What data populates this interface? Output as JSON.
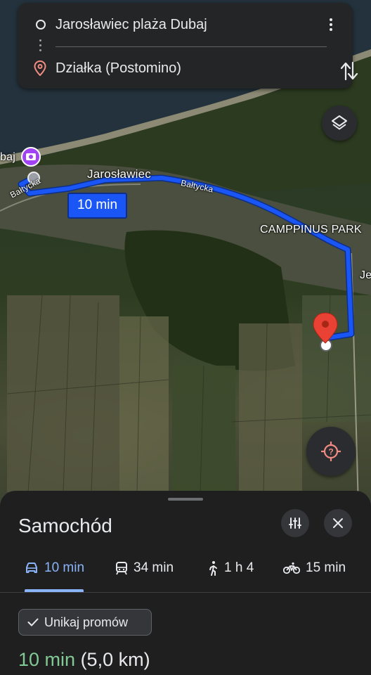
{
  "route_card": {
    "origin": "Jarosławiec plaża Dubaj",
    "destination": "Działka (Postomino)"
  },
  "map": {
    "labels": {
      "place_dubaj": "baj",
      "town": "Jarosławiec",
      "street_left": "Bałtycka",
      "street_right": "Bałtycka",
      "park": "CAMPPINUS PARK",
      "edge_label": "Je"
    },
    "eta_bubble": "10 min",
    "route_color": "#1a56f5",
    "pin_color": "#e94235"
  },
  "sheet": {
    "title": "Samochód",
    "tabs": [
      {
        "icon": "car-icon",
        "label": "10 min",
        "active": true
      },
      {
        "icon": "transit-icon",
        "label": "34 min",
        "active": false
      },
      {
        "icon": "walk-icon",
        "label": "1 h 4",
        "active": false
      },
      {
        "icon": "bike-icon",
        "label": "15 min",
        "active": false
      }
    ],
    "chip": "Unikaj promów",
    "result_time": "10 min",
    "result_distance": "(5,0 km)"
  },
  "colors": {
    "accent": "#8ab4f8",
    "time_green": "#81c995",
    "sheet_bg": "#1f1f20"
  }
}
